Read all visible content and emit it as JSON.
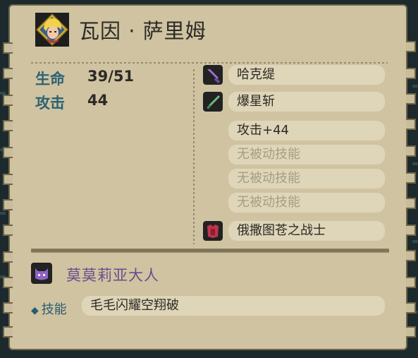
{
  "character": {
    "name": "瓦因 · 萨里姆"
  },
  "stats": [
    {
      "label": "生命",
      "value": "39/51"
    },
    {
      "label": "攻击",
      "value": "44"
    }
  ],
  "equipment": [
    {
      "name": "哈克缇",
      "icon": "purple-sword-icon"
    },
    {
      "name": "爆星斩",
      "icon": "green-sword-icon"
    }
  ],
  "bonus_text": "攻击+44",
  "passive_skills": [
    "无被动技能",
    "无被动技能",
    "无被动技能"
  ],
  "armor": {
    "name": "俄撒图苍之战士",
    "icon": "red-armor-icon"
  },
  "companion": {
    "name": "莫莫莉亚大人",
    "icon": "purple-cat-icon",
    "skill_label": "技能",
    "skill_value": "毛毛闪耀空翔破"
  },
  "colors": {
    "panel": "#cfc3a1",
    "stat_label": "#2d6273",
    "companion_name": "#6c4c8c",
    "empty_text": "#a59c83"
  }
}
